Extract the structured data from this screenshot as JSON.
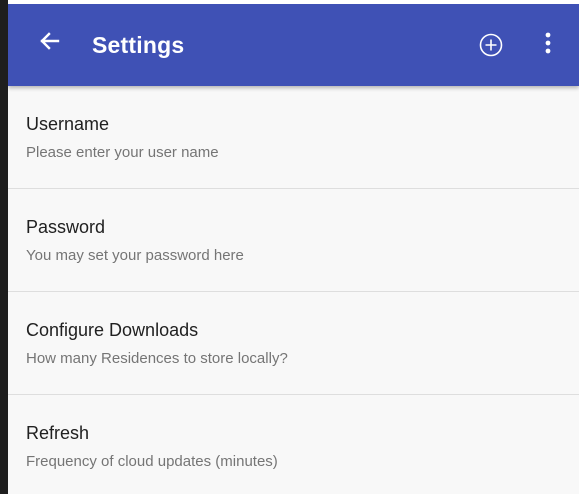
{
  "app_bar": {
    "title": "Settings",
    "back_icon": "arrow-left-icon",
    "add_icon": "add-circle-icon",
    "overflow_icon": "more-vert-icon",
    "color": "#3f51b5"
  },
  "settings": [
    {
      "title": "Username",
      "summary": "Please enter your user name"
    },
    {
      "title": "Password",
      "summary": "You may set your password here"
    },
    {
      "title": "Configure Downloads",
      "summary": "How many Residences to store locally?"
    },
    {
      "title": "Refresh",
      "summary": "Frequency of cloud updates (minutes)"
    }
  ]
}
